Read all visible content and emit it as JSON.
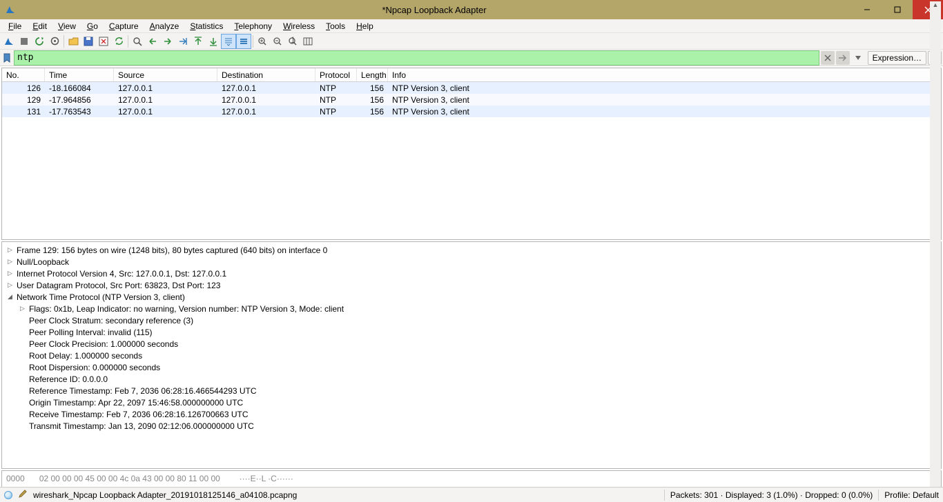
{
  "window": {
    "title": "*Npcap Loopback Adapter"
  },
  "menus": [
    "File",
    "Edit",
    "View",
    "Go",
    "Capture",
    "Analyze",
    "Statistics",
    "Telephony",
    "Wireless",
    "Tools",
    "Help"
  ],
  "filter": {
    "value": "ntp",
    "expression_label": "Expression…"
  },
  "columns": [
    "No.",
    "Time",
    "Source",
    "Destination",
    "Protocol",
    "Length",
    "Info"
  ],
  "packets": [
    {
      "no": "126",
      "time": "-18.166084",
      "src": "127.0.0.1",
      "dst": "127.0.0.1",
      "proto": "NTP",
      "len": "156",
      "info": "NTP Version 3, client"
    },
    {
      "no": "129",
      "time": "-17.964856",
      "src": "127.0.0.1",
      "dst": "127.0.0.1",
      "proto": "NTP",
      "len": "156",
      "info": "NTP Version 3, client"
    },
    {
      "no": "131",
      "time": "-17.763543",
      "src": "127.0.0.1",
      "dst": "127.0.0.1",
      "proto": "NTP",
      "len": "156",
      "info": "NTP Version 3, client"
    }
  ],
  "details": [
    {
      "ind": 0,
      "mark": "▷",
      "text": "Frame 129: 156 bytes on wire (1248 bits), 80 bytes captured (640 bits) on interface 0"
    },
    {
      "ind": 0,
      "mark": "▷",
      "text": "Null/Loopback"
    },
    {
      "ind": 0,
      "mark": "▷",
      "text": "Internet Protocol Version 4, Src: 127.0.0.1, Dst: 127.0.0.1"
    },
    {
      "ind": 0,
      "mark": "▷",
      "text": "User Datagram Protocol, Src Port: 63823, Dst Port: 123"
    },
    {
      "ind": 0,
      "mark": "◢",
      "text": "Network Time Protocol (NTP Version 3, client)"
    },
    {
      "ind": 1,
      "mark": "▷",
      "text": "Flags: 0x1b, Leap Indicator: no warning, Version number: NTP Version 3, Mode: client"
    },
    {
      "ind": 1,
      "mark": "",
      "text": "Peer Clock Stratum: secondary reference (3)"
    },
    {
      "ind": 1,
      "mark": "",
      "text": "Peer Polling Interval: invalid (115)"
    },
    {
      "ind": 1,
      "mark": "",
      "text": "Peer Clock Precision: 1.000000 seconds"
    },
    {
      "ind": 1,
      "mark": "",
      "text": "Root Delay: 1.000000 seconds"
    },
    {
      "ind": 1,
      "mark": "",
      "text": "Root Dispersion: 0.000000 seconds"
    },
    {
      "ind": 1,
      "mark": "",
      "text": "Reference ID: 0.0.0.0"
    },
    {
      "ind": 1,
      "mark": "",
      "text": "Reference Timestamp: Feb  7, 2036 06:28:16.466544293 UTC"
    },
    {
      "ind": 1,
      "mark": "",
      "text": "Origin Timestamp: Apr 22, 2097 15:46:58.000000000 UTC"
    },
    {
      "ind": 1,
      "mark": "",
      "text": "Receive Timestamp: Feb  7, 2036 06:28:16.126700663 UTC"
    },
    {
      "ind": 1,
      "mark": "",
      "text": "Transmit Timestamp: Jan 13, 2090 02:12:06.000000000 UTC"
    }
  ],
  "hex": {
    "offset": "0000",
    "bytes": "02 00 00 00 45 00 00 4c  0a 43 00 00 80 11 00 00",
    "ascii": "····E··L ·C······"
  },
  "status": {
    "file": "wireshark_Npcap Loopback Adapter_20191018125146_a04108.pcapng",
    "packets": "Packets: 301 · Displayed: 3 (1.0%) · Dropped: 0 (0.0%)",
    "profile": "Profile: Default"
  },
  "icons": {
    "fin": "shark-fin",
    "stop": "stop",
    "restart": "restart",
    "opts": "options",
    "open": "folder-open",
    "save": "save",
    "close": "close-file",
    "reload": "reload",
    "find": "find",
    "prev": "prev",
    "next": "next",
    "jump": "jump",
    "first": "first",
    "last": "last",
    "auto": "autoscroll",
    "flow": "colorize",
    "zoomin": "zoomin",
    "zoomout": "zoomout",
    "zoom1": "zoom1",
    "cols": "columns"
  }
}
